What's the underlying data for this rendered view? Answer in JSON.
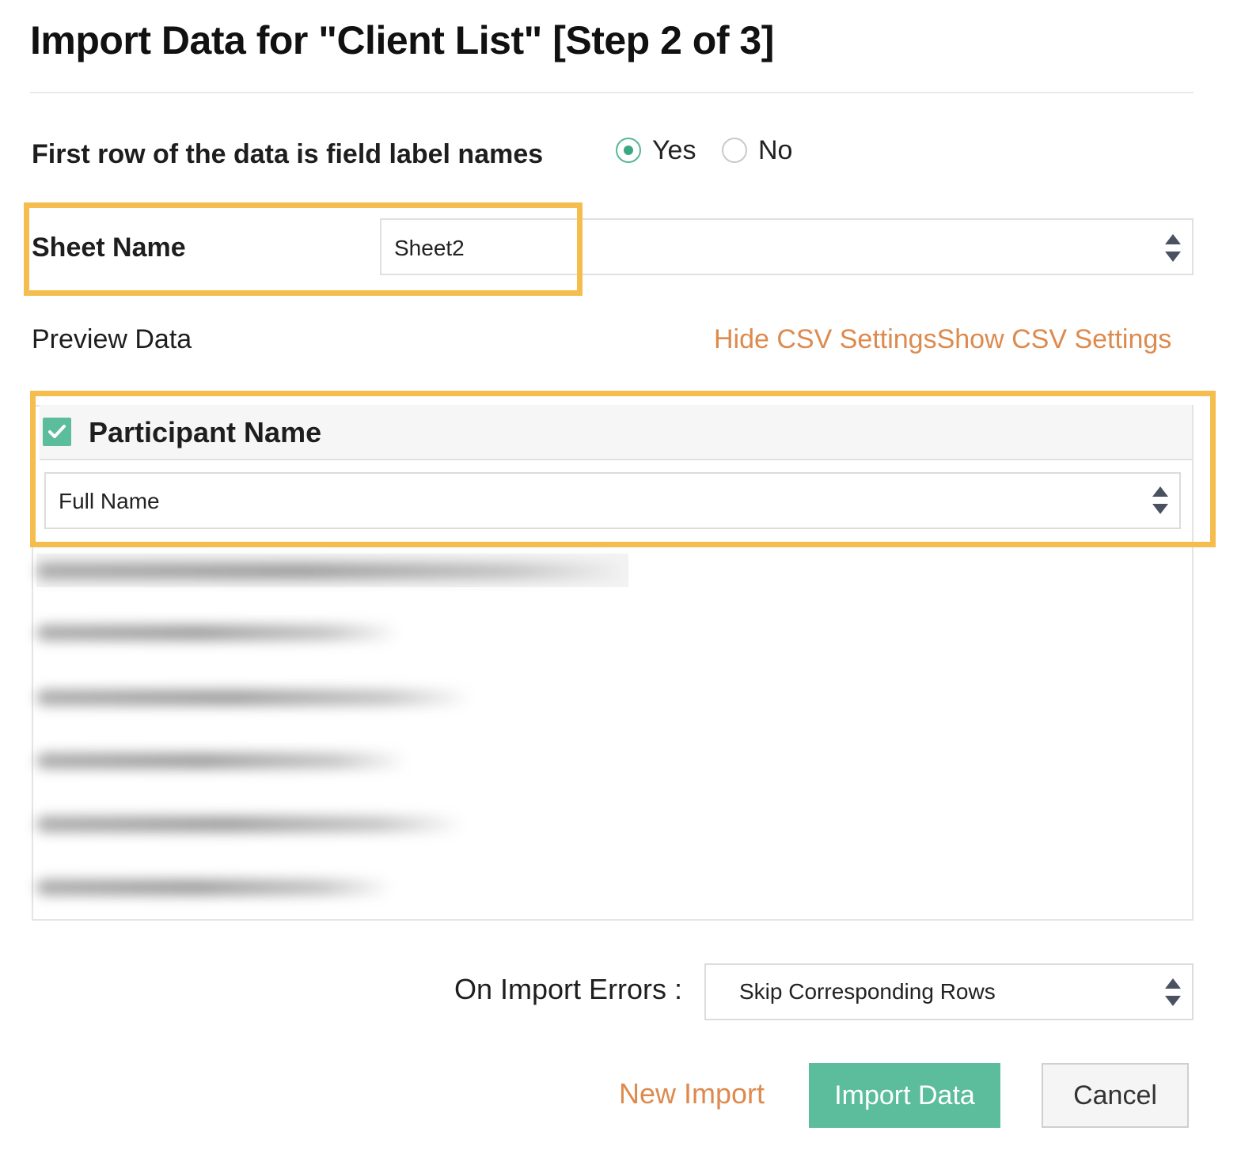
{
  "dialog": {
    "title": "Import Data for \"Client List\" [Step 2 of 3]"
  },
  "first_row": {
    "label": "First row of the data is field label names",
    "options": [
      {
        "label": "Yes",
        "selected": true
      },
      {
        "label": "No",
        "selected": false
      }
    ]
  },
  "sheet": {
    "label": "Sheet Name",
    "selected": "Sheet2"
  },
  "preview": {
    "label": "Preview Data",
    "hide_csv_label": "Hide CSV Settings",
    "show_csv_label": "Show CSV Settings",
    "column": {
      "name": "Participant Name",
      "checked": true,
      "field_mapping": "Full Name"
    }
  },
  "errors": {
    "label": "On Import Errors :",
    "selected": "Skip Corresponding Rows"
  },
  "actions": {
    "new_import_label": "New Import",
    "import_label": "Import Data",
    "cancel_label": "Cancel"
  },
  "colors": {
    "accent_green": "#5bbd9b",
    "link_orange": "#dd8a4e",
    "highlight_yellow": "#f4bd4e"
  }
}
